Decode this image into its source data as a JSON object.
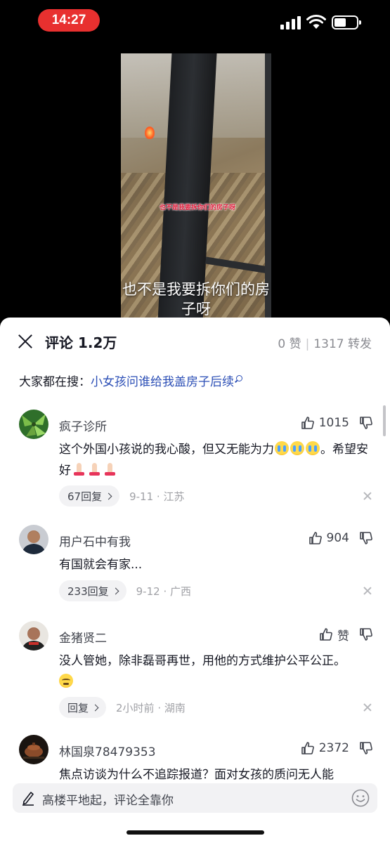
{
  "status": {
    "time": "14:27"
  },
  "video": {
    "caption_red": "也不是我要拆你们的房子呀",
    "caption": "也不是我要拆你们的房子呀"
  },
  "comments_panel": {
    "title": "评论 1.2万",
    "likes": "0 赞",
    "shares": "1317 转发",
    "search_prefix": "大家都在搜：",
    "search_suggestion": "小女孩问谁给我盖房子后续"
  },
  "comments": [
    {
      "username": "疯子诊所",
      "likes": "1015",
      "text_a": "这个外国小孩说的我心酸，但又无能为力",
      "text_b": "。希望安好",
      "replies": "67回复",
      "meta": "9-11 · 江苏"
    },
    {
      "username": "用户石中有我",
      "likes": "904",
      "text": "有国就会有家...",
      "replies": "233回复",
      "meta": "9-12 · 广西"
    },
    {
      "username": "金猪贤二",
      "likes": "赞",
      "text": "没人管她，除非磊哥再世，用他的方式维护公平公正。",
      "replies": "回复",
      "meta": "2小时前 · 湖南"
    },
    {
      "username": "林国泉78479353",
      "likes": "2372",
      "text": "焦点访谈为什么不追踪报道？面对女孩的质问无人能"
    }
  ],
  "input": {
    "placeholder": "高楼平地起，评论全靠你"
  },
  "colors": {
    "link": "#2c4fb6",
    "time_pill": "#e8302f"
  }
}
